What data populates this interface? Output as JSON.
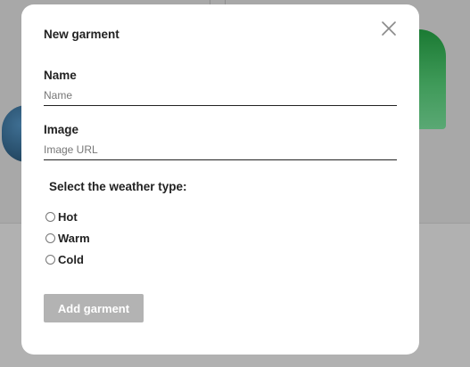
{
  "modal": {
    "title": "New garment",
    "close_icon": "close-icon"
  },
  "fields": {
    "name": {
      "label": "Name",
      "placeholder": "Name",
      "value": ""
    },
    "image": {
      "label": "Image",
      "placeholder": "Image URL",
      "value": ""
    }
  },
  "weather": {
    "heading": "Select the weather type:",
    "options": [
      {
        "label": "Hot",
        "value": "hot",
        "checked": false
      },
      {
        "label": "Warm",
        "value": "warm",
        "checked": false
      },
      {
        "label": "Cold",
        "value": "cold",
        "checked": false
      }
    ]
  },
  "actions": {
    "submit_label": "Add garment",
    "submit_disabled": true
  },
  "colors": {
    "overlay": "#a8a8a8",
    "modal_bg": "#ffffff",
    "button_disabled": "#b3b3b3",
    "background_green": "#1b7a33",
    "background_blue": "#284f6c"
  }
}
